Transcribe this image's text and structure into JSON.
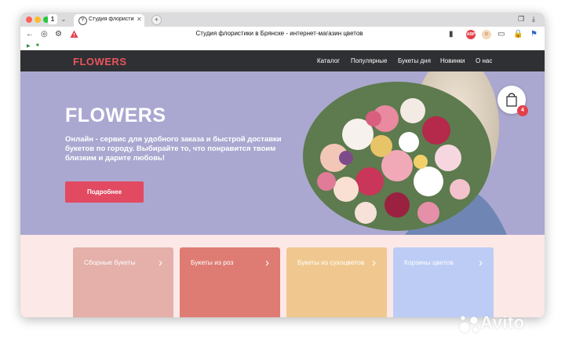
{
  "browser": {
    "tab_count": "1",
    "tab_title": "Студия флористики в Б",
    "page_title": "Студия флористики в Брянске - интернет-магазин цветов",
    "ext_badge": "ABP"
  },
  "site": {
    "logo": "FLOWERS",
    "menu": [
      "Каталог",
      "Популярные",
      "Букеты дня",
      "Новинки",
      "О нас"
    ],
    "hero_title": "FLOWERS",
    "hero_desc": "Онлайн - сервис для удобного заказа и быстрой доставки букетов по городу. Выбирайте то, что понравится твоим близким и дарите любовь!",
    "hero_button": "Подробнее",
    "cart_count": "4",
    "categories": [
      {
        "label": "Сборные букеты",
        "color": "#e4b0a9"
      },
      {
        "label": "Букеты из роз",
        "color": "#de7c74"
      },
      {
        "label": "Букеты из сухоцветов",
        "color": "#f0c88f"
      },
      {
        "label": "Корзины цветов",
        "color": "#bcccf5"
      }
    ]
  },
  "watermark": "Avito",
  "colors": {
    "accent": "#e8555e",
    "header_bg": "#2f3033",
    "hero_bg": "#aaa8d0",
    "button": "#e14a60"
  }
}
